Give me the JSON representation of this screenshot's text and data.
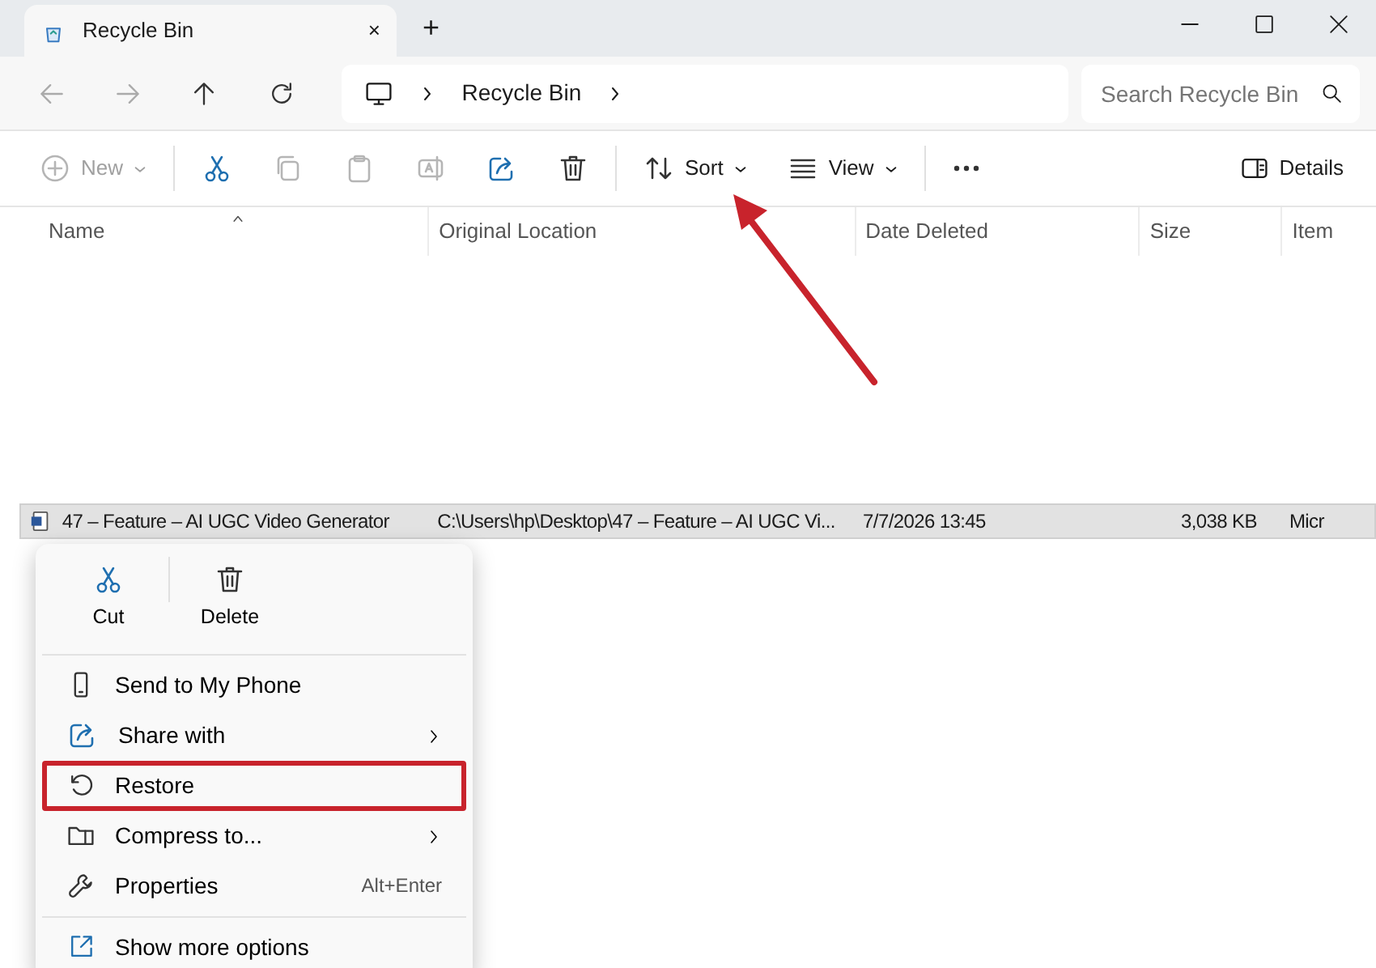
{
  "tab": {
    "title": "Recycle Bin",
    "close": "×",
    "new_tab": "+"
  },
  "address": {
    "crumbs": [
      "Recycle Bin"
    ]
  },
  "search": {
    "placeholder": "Search Recycle Bin"
  },
  "toolbar": [
    {
      "kind": "new",
      "label": "New",
      "disabled": true,
      "dropdown": true
    },
    {
      "kind": "cut",
      "disabled": false
    },
    {
      "kind": "copy",
      "disabled": true
    },
    {
      "kind": "paste",
      "disabled": true
    },
    {
      "kind": "rename",
      "disabled": true
    },
    {
      "kind": "share",
      "disabled": false
    },
    {
      "kind": "delete",
      "disabled": false
    },
    {
      "kind": "sort",
      "label": "Sort",
      "disabled": false,
      "dropdown": true
    },
    {
      "kind": "view",
      "label": "View",
      "disabled": false,
      "dropdown": true
    },
    {
      "kind": "more",
      "disabled": false
    }
  ],
  "details_button": {
    "label": "Details"
  },
  "table": {
    "columns": [
      "Name",
      "Original Location",
      "Date Deleted",
      "Size",
      "Item"
    ],
    "rows": [
      {
        "selected": true,
        "cells": [
          "47 – Feature – AI UGC Video Generator",
          "C:\\Users\\hp\\Desktop\\47 – Feature – AI UGC Vi...",
          "7/7/2026 13:45",
          "3,038 KB",
          "Micr"
        ]
      }
    ]
  },
  "context_menu": {
    "quick_actions": [
      {
        "kind": "cut",
        "label": "Cut"
      },
      {
        "kind": "delete",
        "label": "Delete"
      }
    ],
    "items": [
      {
        "kind": "phone",
        "label": "Send to My Phone",
        "submenu": false,
        "highlighted": false
      },
      {
        "kind": "share",
        "label": "Share with",
        "submenu": true,
        "highlighted": false
      },
      {
        "kind": "restore",
        "label": "Restore",
        "submenu": false,
        "highlighted": true
      },
      {
        "kind": "compress",
        "label": "Compress to...",
        "submenu": true,
        "highlighted": false
      },
      {
        "kind": "properties",
        "label": "Properties",
        "shortcut": "Alt+Enter",
        "submenu": false,
        "highlighted": false
      }
    ],
    "footer_items": [
      {
        "kind": "moreopts",
        "label": "Show more options"
      }
    ]
  },
  "annotation": {
    "arrow": true
  }
}
